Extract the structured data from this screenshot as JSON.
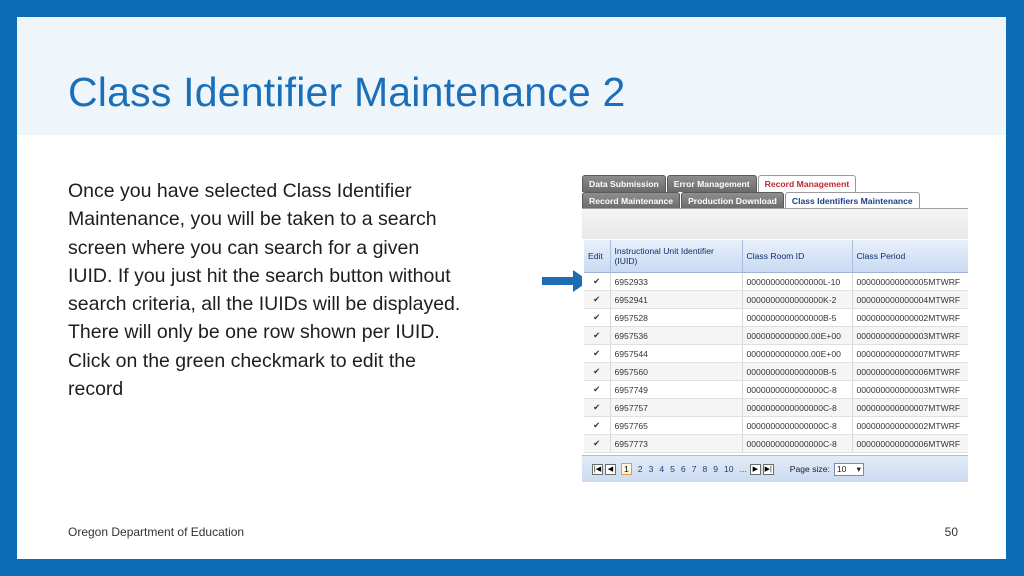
{
  "slide": {
    "title": "Class Identifier Maintenance 2",
    "body": [
      "Once you have selected Class Identifier Maintenance, you will be taken to a search screen where you can search for a given IUID. If you just hit the search button without search criteria, all the IUIDs will be displayed.",
      "There will only be one row shown per IUID.",
      "Click on the green checkmark to edit the record"
    ],
    "footer": "Oregon Department of Education",
    "page_number": "50"
  },
  "screenshot": {
    "tabs_row1": [
      "Data Submission",
      "Error Management",
      "Record Management"
    ],
    "tabs_row2": [
      "Record Maintenance",
      "Production Download",
      "Class Identifiers Maintenance"
    ],
    "columns": [
      "Edit",
      "Instructional Unit Identifier (IUID)",
      "Class Room ID",
      "Class Period"
    ],
    "rows": [
      {
        "iuid": "6952933",
        "room": "0000000000000000L-10",
        "period": "000000000000005MTWRF"
      },
      {
        "iuid": "6952941",
        "room": "0000000000000000K-2",
        "period": "000000000000004MTWRF"
      },
      {
        "iuid": "6957528",
        "room": "0000000000000000B-5",
        "period": "000000000000002MTWRF"
      },
      {
        "iuid": "6957536",
        "room": "0000000000000.00E+00",
        "period": "000000000000003MTWRF"
      },
      {
        "iuid": "6957544",
        "room": "0000000000000.00E+00",
        "period": "000000000000007MTWRF"
      },
      {
        "iuid": "6957560",
        "room": "0000000000000000B-5",
        "period": "000000000000006MTWRF"
      },
      {
        "iuid": "6957749",
        "room": "0000000000000000C-8",
        "period": "000000000000003MTWRF"
      },
      {
        "iuid": "6957757",
        "room": "0000000000000000C-8",
        "period": "000000000000007MTWRF"
      },
      {
        "iuid": "6957765",
        "room": "0000000000000000C-8",
        "period": "000000000000002MTWRF"
      },
      {
        "iuid": "6957773",
        "room": "0000000000000000C-8",
        "period": "000000000000006MTWRF"
      }
    ],
    "pager": {
      "pages": [
        "1",
        "2",
        "3",
        "4",
        "5",
        "6",
        "7",
        "8",
        "9",
        "10",
        "..."
      ],
      "page_size_label": "Page size:",
      "page_size_value": "10"
    }
  },
  "icons": {
    "edit": "checkmark-icon",
    "first": "first-page-icon",
    "prev": "prev-page-icon",
    "next": "next-page-icon",
    "last": "last-page-icon",
    "arrow": "pointer-arrow-icon"
  },
  "colors": {
    "frame": "#0b6bb5",
    "title": "#1a6fb8",
    "check": "#2e9e2e",
    "arrow": "#1f6cb0"
  }
}
